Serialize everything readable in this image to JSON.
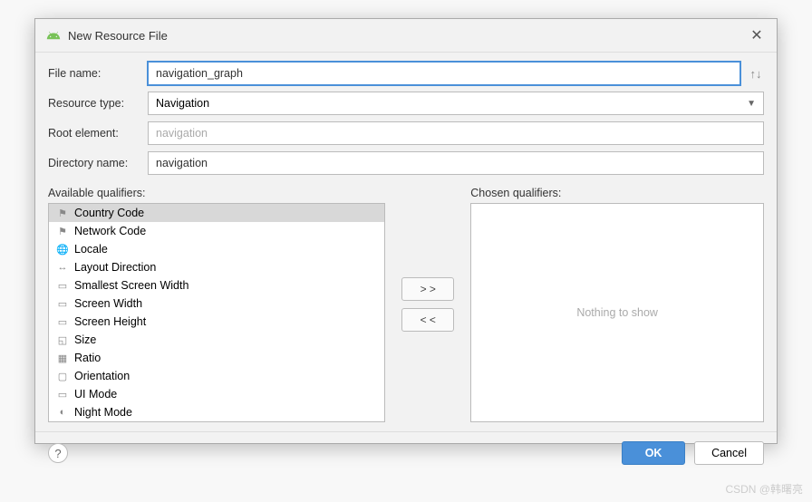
{
  "dialog": {
    "title": "New Resource File"
  },
  "fields": {
    "file_name_label": "File name:",
    "file_name_value": "navigation_graph",
    "resource_type_label": "Resource type:",
    "resource_type_value": "Navigation",
    "root_element_label": "Root element:",
    "root_element_value": "navigation",
    "directory_name_label": "Directory name:",
    "directory_name_value": "navigation"
  },
  "qualifiers": {
    "available_label": "Available qualifiers:",
    "chosen_label": "Chosen qualifiers:",
    "empty_text": "Nothing to show",
    "move_right": "> >",
    "move_left": "< <",
    "items": [
      {
        "label": "Country Code",
        "icon": "flag",
        "selected": true
      },
      {
        "label": "Network Code",
        "icon": "flag",
        "selected": false
      },
      {
        "label": "Locale",
        "icon": "globe",
        "selected": false
      },
      {
        "label": "Layout Direction",
        "icon": "arrows",
        "selected": false
      },
      {
        "label": "Smallest Screen Width",
        "icon": "screen",
        "selected": false
      },
      {
        "label": "Screen Width",
        "icon": "screen",
        "selected": false
      },
      {
        "label": "Screen Height",
        "icon": "screen",
        "selected": false
      },
      {
        "label": "Size",
        "icon": "size",
        "selected": false
      },
      {
        "label": "Ratio",
        "icon": "ratio",
        "selected": false
      },
      {
        "label": "Orientation",
        "icon": "orient",
        "selected": false
      },
      {
        "label": "UI Mode",
        "icon": "ui",
        "selected": false
      },
      {
        "label": "Night Mode",
        "icon": "night",
        "selected": false
      }
    ]
  },
  "buttons": {
    "help": "?",
    "ok": "OK",
    "cancel": "Cancel"
  },
  "watermark": "CSDN @韩曙亮",
  "icons": {
    "flag": "⚑",
    "globe": "🌐",
    "arrows": "↔",
    "screen": "▭",
    "size": "◱",
    "ratio": "▦",
    "orient": "▢",
    "ui": "▭",
    "night": "◐"
  }
}
